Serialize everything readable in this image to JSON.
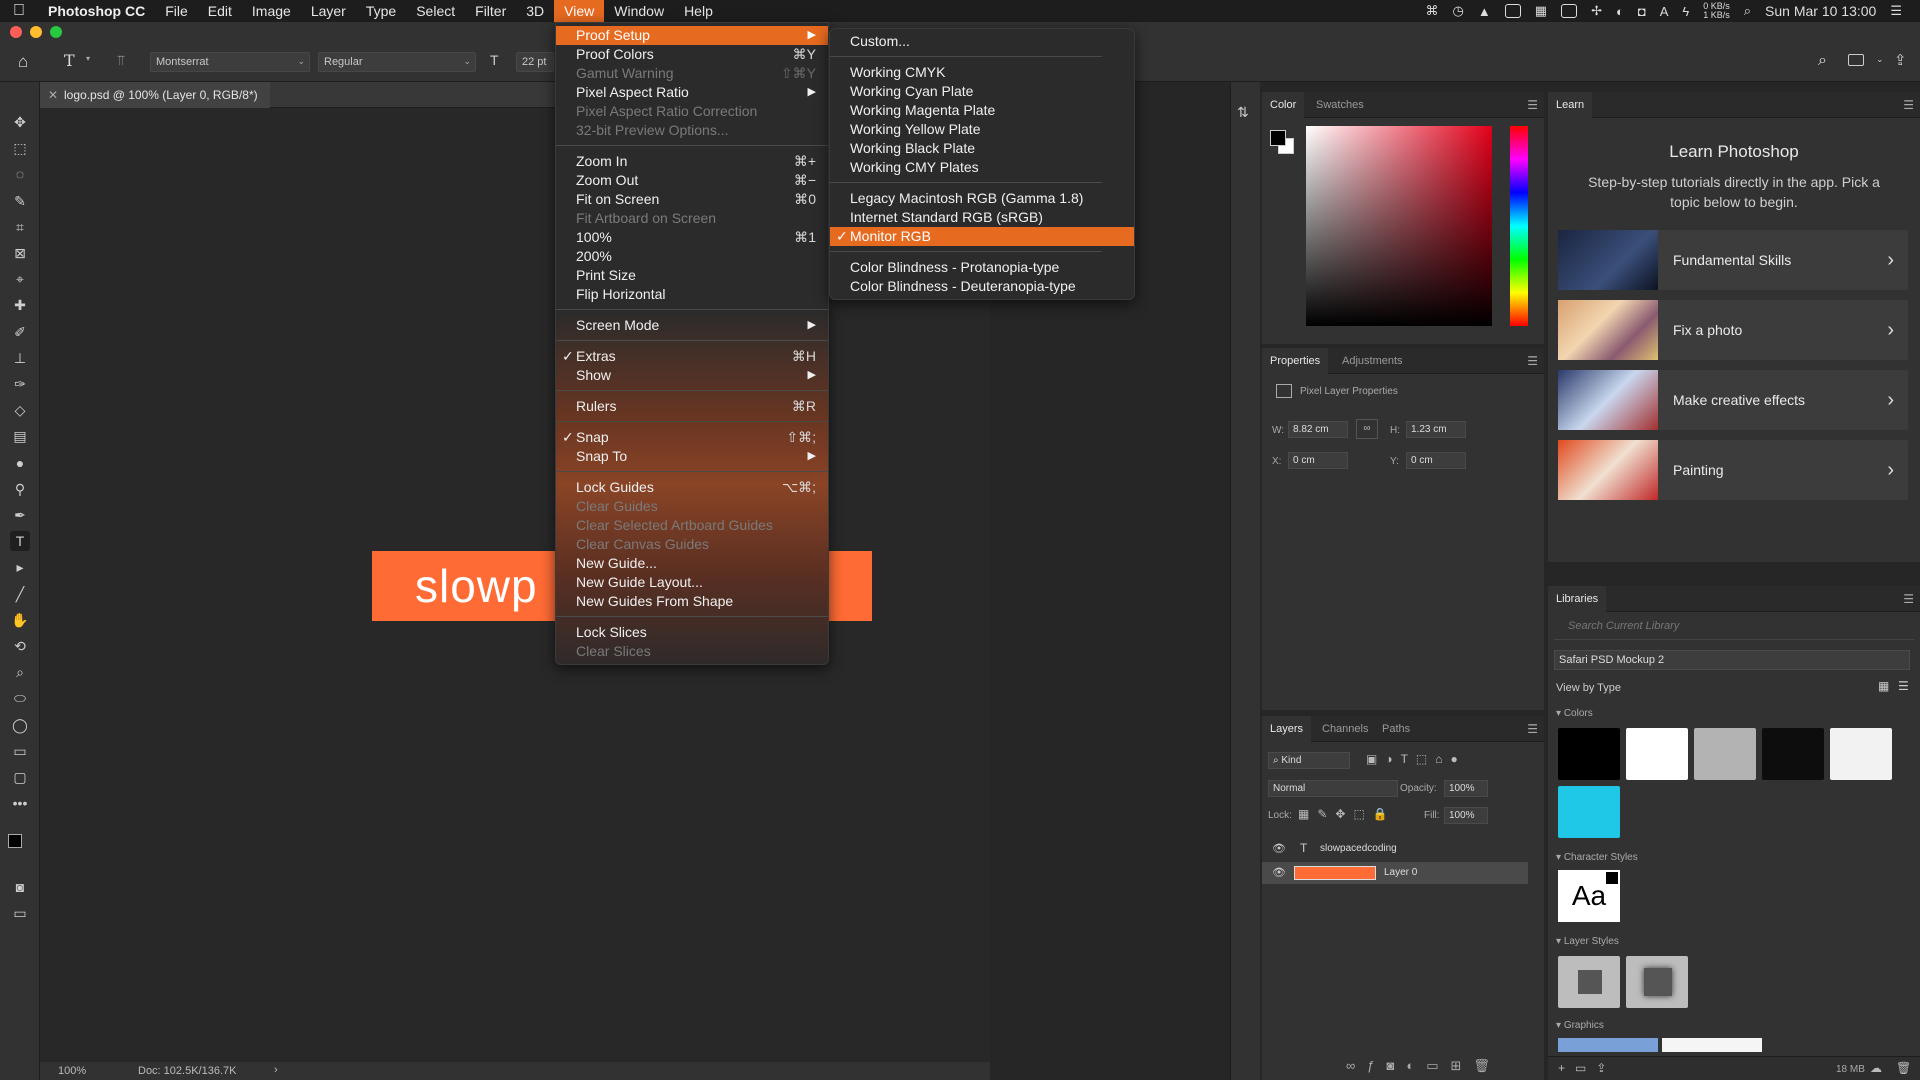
{
  "menubar": {
    "apple": "",
    "app_name": "Photoshop CC",
    "items": [
      "File",
      "Edit",
      "Image",
      "Layer",
      "Type",
      "Select",
      "Filter",
      "3D",
      "View",
      "Window",
      "Help"
    ],
    "active": "View",
    "net_up": "0 KB/s",
    "net_down": "1 KB/s",
    "datetime": "Sun Mar 10  13:00"
  },
  "options": {
    "font_family": "Montserrat",
    "font_style": "Regular",
    "font_size": "22 pt"
  },
  "document": {
    "tab_title": "logo.psd @ 100% (Layer 0, RGB/8*)",
    "artwork_text": "slowp",
    "zoom": "100%",
    "doc_size": "Doc: 102.5K/136.7K",
    "artwork_color": "#ff6b35"
  },
  "view_menu": [
    {
      "label": "Proof Setup",
      "arrow": true,
      "highlight": true
    },
    {
      "label": "Proof Colors",
      "shortcut": "⌘Y"
    },
    {
      "label": "Gamut Warning",
      "shortcut": "⇧⌘Y",
      "disabled": true
    },
    {
      "label": "Pixel Aspect Ratio",
      "arrow": true
    },
    {
      "label": "Pixel Aspect Ratio Correction",
      "disabled": true
    },
    {
      "label": "32-bit Preview Options...",
      "disabled": true
    },
    {
      "sep": true
    },
    {
      "label": "Zoom In",
      "shortcut": "⌘+"
    },
    {
      "label": "Zoom Out",
      "shortcut": "⌘−"
    },
    {
      "label": "Fit on Screen",
      "shortcut": "⌘0"
    },
    {
      "label": "Fit Artboard on Screen",
      "disabled": true
    },
    {
      "label": "100%",
      "shortcut": "⌘1"
    },
    {
      "label": "200%"
    },
    {
      "label": "Print Size"
    },
    {
      "label": "Flip Horizontal"
    },
    {
      "sep": true
    },
    {
      "label": "Screen Mode",
      "arrow": true
    },
    {
      "sep": true
    },
    {
      "label": "Extras",
      "shortcut": "⌘H",
      "checked": true
    },
    {
      "label": "Show",
      "arrow": true
    },
    {
      "sep": true
    },
    {
      "label": "Rulers",
      "shortcut": "⌘R"
    },
    {
      "sep": true
    },
    {
      "label": "Snap",
      "shortcut": "⇧⌘;",
      "checked": true
    },
    {
      "label": "Snap To",
      "arrow": true
    },
    {
      "sep": true
    },
    {
      "label": "Lock Guides",
      "shortcut": "⌥⌘;"
    },
    {
      "label": "Clear Guides",
      "disabled": true
    },
    {
      "label": "Clear Selected Artboard Guides",
      "disabled": true
    },
    {
      "label": "Clear Canvas Guides",
      "disabled": true
    },
    {
      "label": "New Guide..."
    },
    {
      "label": "New Guide Layout..."
    },
    {
      "label": "New Guides From Shape"
    },
    {
      "sep": true
    },
    {
      "label": "Lock Slices"
    },
    {
      "label": "Clear Slices",
      "disabled": true
    }
  ],
  "proof_submenu": [
    {
      "label": "Custom..."
    },
    {
      "sep": true
    },
    {
      "label": "Working CMYK"
    },
    {
      "label": "Working Cyan Plate"
    },
    {
      "label": "Working Magenta Plate"
    },
    {
      "label": "Working Yellow Plate"
    },
    {
      "label": "Working Black Plate"
    },
    {
      "label": "Working CMY Plates"
    },
    {
      "sep": true
    },
    {
      "label": "Legacy Macintosh RGB (Gamma 1.8)"
    },
    {
      "label": "Internet Standard RGB (sRGB)"
    },
    {
      "label": "Monitor RGB",
      "checked": true,
      "highlight": true
    },
    {
      "sep": true
    },
    {
      "label": "Color Blindness - Protanopia-type"
    },
    {
      "label": "Color Blindness - Deuteranopia-type"
    }
  ],
  "color_panel": {
    "tab_color": "Color",
    "tab_swatches": "Swatches"
  },
  "properties_panel": {
    "tab_properties": "Properties",
    "tab_adjustments": "Adjustments",
    "header": "Pixel Layer Properties",
    "w_label": "W:",
    "w": "8.82 cm",
    "h_label": "H:",
    "h": "1.23 cm",
    "x_label": "X:",
    "x": "0 cm",
    "y_label": "Y:",
    "y": "0 cm"
  },
  "layers_panel": {
    "tab_layers": "Layers",
    "tab_channels": "Channels",
    "tab_paths": "Paths",
    "filter": "Kind",
    "blend": "Normal",
    "opacity_label": "Opacity:",
    "opacity": "100%",
    "lock_label": "Lock:",
    "fill_label": "Fill:",
    "fill": "100%",
    "layers": [
      {
        "name": "slowpacedcoding",
        "type": "text"
      },
      {
        "name": "Layer 0",
        "type": "pixel"
      }
    ]
  },
  "learn_panel": {
    "tab": "Learn",
    "title": "Learn Photoshop",
    "subtitle": "Step-by-step tutorials directly in the app. Pick a topic below to begin.",
    "cards": [
      "Fundamental Skills",
      "Fix a photo",
      "Make creative effects",
      "Painting"
    ]
  },
  "libraries_panel": {
    "tab": "Libraries",
    "search_placeholder": "Search Current Library",
    "library": "Safari PSD Mockup 2",
    "view_by": "View by Type",
    "sec_colors": "Colors",
    "colors": [
      "#000000",
      "#ffffff",
      "#b3b3b3",
      "#0d0d0d",
      "#f2f2f2",
      "#1ec8e6"
    ],
    "sec_char": "Character Styles",
    "char_sample": "Aa",
    "sec_layer": "Layer Styles",
    "sec_graphics": "Graphics",
    "size": "18 MB"
  },
  "accent": "#e66a20"
}
